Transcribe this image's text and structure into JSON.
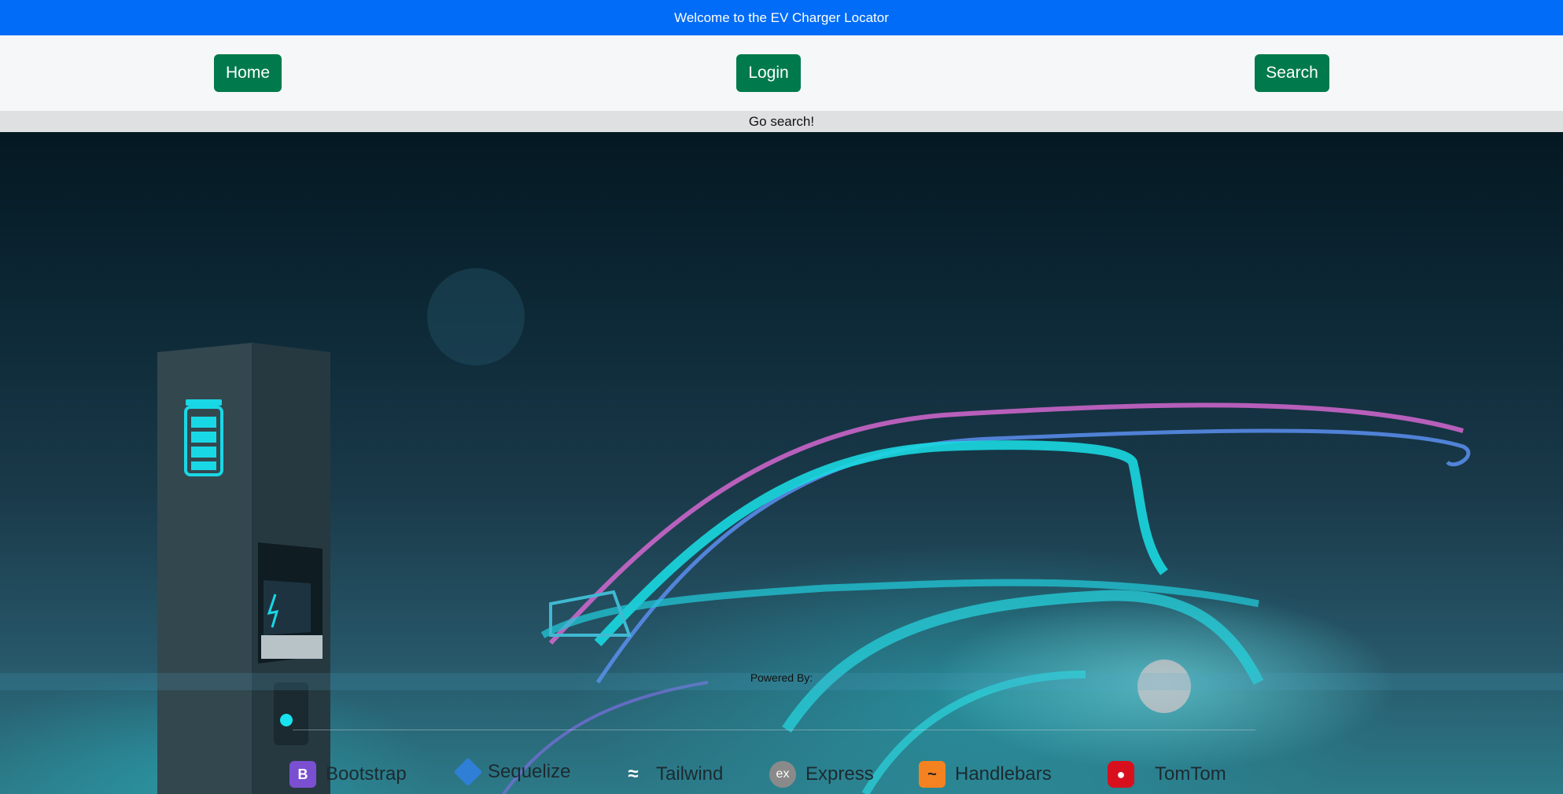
{
  "header": {
    "title": "Welcome to the EV Charger Locator"
  },
  "nav": {
    "home_label": "Home",
    "login_label": "Login",
    "search_label": "Search"
  },
  "subbar": {
    "text": "Go search!"
  },
  "powered": {
    "label": "Powered By:",
    "items": [
      {
        "name": "Bootstrap",
        "icon": "bootstrap-icon",
        "color": "#7a4fd1"
      },
      {
        "name": "Sequelize",
        "icon": "sequelize-icon",
        "color": "#2f7fd6"
      },
      {
        "name": "Tailwind",
        "icon": "tailwind-icon",
        "color": "#ffffff"
      },
      {
        "name": "Express",
        "icon": "express-icon",
        "color": "#8a8a8a"
      },
      {
        "name": "Handlebars",
        "icon": "handlebars-icon",
        "color": "#f58220"
      },
      {
        "name": "TomTom",
        "icon": "tomtom-icon",
        "color": "#d8101e"
      }
    ]
  },
  "colors": {
    "topbar": "#006cf7",
    "button": "#007a4c",
    "navbar": "#f6f7f9",
    "subbar": "#dfe0e2"
  }
}
